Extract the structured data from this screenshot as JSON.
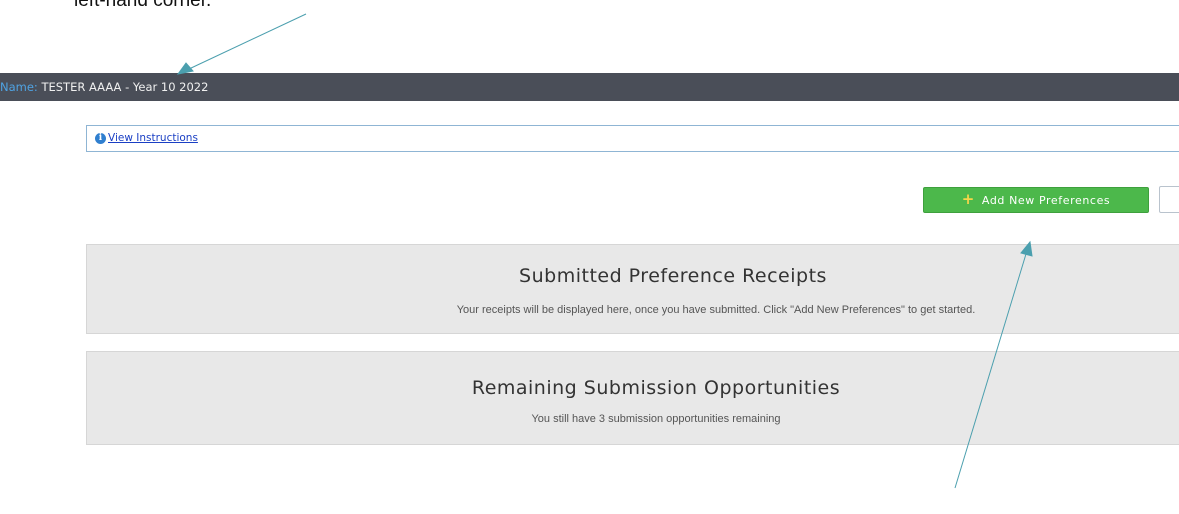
{
  "caption": "left-hand corner.",
  "topbar": {
    "name_label": "Name:",
    "name_value": " TESTER AAAA - Year 10 2022"
  },
  "instructions": {
    "link_label": "View Instructions",
    "icon": "info-icon"
  },
  "add_button": {
    "label": "Add New Preferences",
    "icon": "plus-icon"
  },
  "receipts": {
    "title": "Submitted Preference Receipts",
    "text": "Your receipts will be displayed here, once you have submitted. Click \"Add New Preferences\" to get started."
  },
  "remaining": {
    "title": "Remaining Submission Opportunities",
    "text": "You still have 3 submission opportunities remaining"
  },
  "colors": {
    "topbar": "#4a4e58",
    "accent_green": "#4cb84b",
    "arrow": "#4b9fae",
    "panel": "#e8e8e8"
  }
}
